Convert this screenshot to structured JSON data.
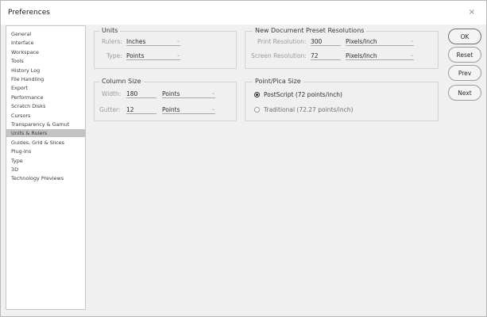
{
  "window": {
    "title": "Preferences",
    "close_glyph": "×"
  },
  "sidebar": {
    "items": [
      {
        "label": "General",
        "selected": false
      },
      {
        "label": "Interface",
        "selected": false
      },
      {
        "label": "Workspace",
        "selected": false
      },
      {
        "label": "Tools",
        "selected": false
      },
      {
        "label": "History Log",
        "selected": false
      },
      {
        "label": "File Handling",
        "selected": false
      },
      {
        "label": "Export",
        "selected": false
      },
      {
        "label": "Performance",
        "selected": false
      },
      {
        "label": "Scratch Disks",
        "selected": false
      },
      {
        "label": "Cursors",
        "selected": false
      },
      {
        "label": "Transparency & Gamut",
        "selected": false
      },
      {
        "label": "Units & Rulers",
        "selected": true
      },
      {
        "label": "Guides, Grid & Slices",
        "selected": false
      },
      {
        "label": "Plug-Ins",
        "selected": false
      },
      {
        "label": "Type",
        "selected": false
      },
      {
        "label": "3D",
        "selected": false
      },
      {
        "label": "Technology Previews",
        "selected": false
      }
    ]
  },
  "units": {
    "title": "Units",
    "rulers_label": "Rulers:",
    "rulers_value": "Inches",
    "type_label": "Type:",
    "type_value": "Points"
  },
  "column_size": {
    "title": "Column Size",
    "width_label": "Width:",
    "width_value": "180",
    "width_unit": "Points",
    "gutter_label": "Gutter:",
    "gutter_value": "12",
    "gutter_unit": "Points"
  },
  "preset_resolutions": {
    "title": "New Document Preset Resolutions",
    "print_label": "Print Resolution:",
    "print_value": "300",
    "print_unit": "Pixels/Inch",
    "screen_label": "Screen Resolution:",
    "screen_value": "72",
    "screen_unit": "Pixels/Inch"
  },
  "point_pica": {
    "title": "Point/Pica Size",
    "options": [
      {
        "label": "PostScript (72 points/inch)",
        "checked": true
      },
      {
        "label": "Traditional (72.27 points/inch)",
        "checked": false
      }
    ]
  },
  "buttons": {
    "ok": "OK",
    "reset": "Reset",
    "prev": "Prev",
    "next": "Next"
  },
  "icons": {
    "chevron": "chevron-down-icon",
    "close": "close-icon"
  },
  "colors": {
    "selected_item_bg": "#c3c3c3",
    "dialog_bg": "#f0f0f0"
  }
}
